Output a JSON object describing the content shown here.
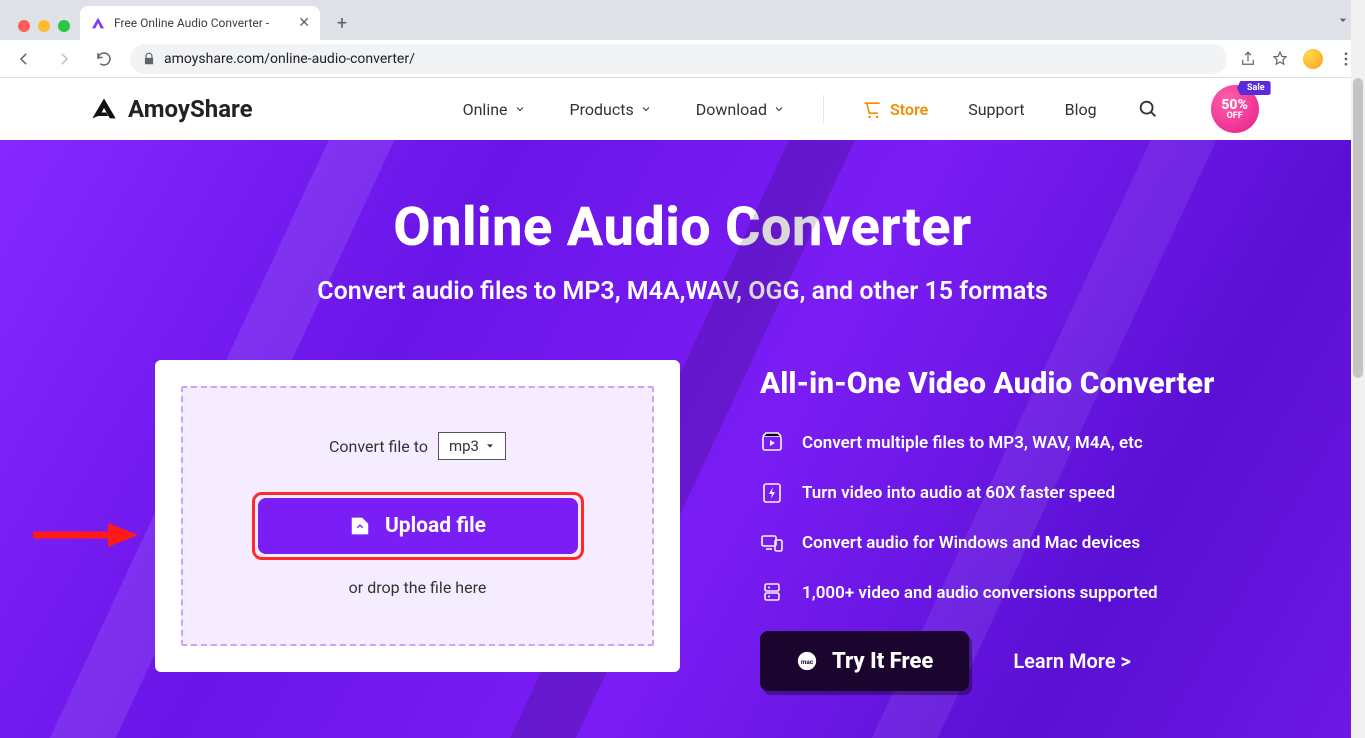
{
  "browser": {
    "tab_title": "Free Online Audio Converter - ",
    "url": "amoyshare.com/online-audio-converter/"
  },
  "header": {
    "brand": "AmoyShare",
    "nav": {
      "online": "Online",
      "products": "Products",
      "download": "Download"
    },
    "store": "Store",
    "support": "Support",
    "blog": "Blog",
    "sale_tag": "Sale",
    "sale_pct": "50%",
    "sale_off": "OFF"
  },
  "hero": {
    "title": "Online Audio Converter",
    "subtitle": "Convert audio files to MP3, M4A,WAV, OGG, and other 15 formats",
    "convert_label": "Convert file to",
    "format_selected": "mp3",
    "upload_label": "Upload file",
    "drop_label": "or drop the file here"
  },
  "right": {
    "title": "All-in-One Video Audio Converter",
    "features": [
      "Convert multiple files to MP3, WAV, M4A, etc",
      "Turn video into audio at 60X faster speed",
      "Convert audio for Windows and Mac devices",
      "1,000+ video and audio conversions supported"
    ],
    "try_label": "Try It Free",
    "learn_label": "Learn More >"
  }
}
